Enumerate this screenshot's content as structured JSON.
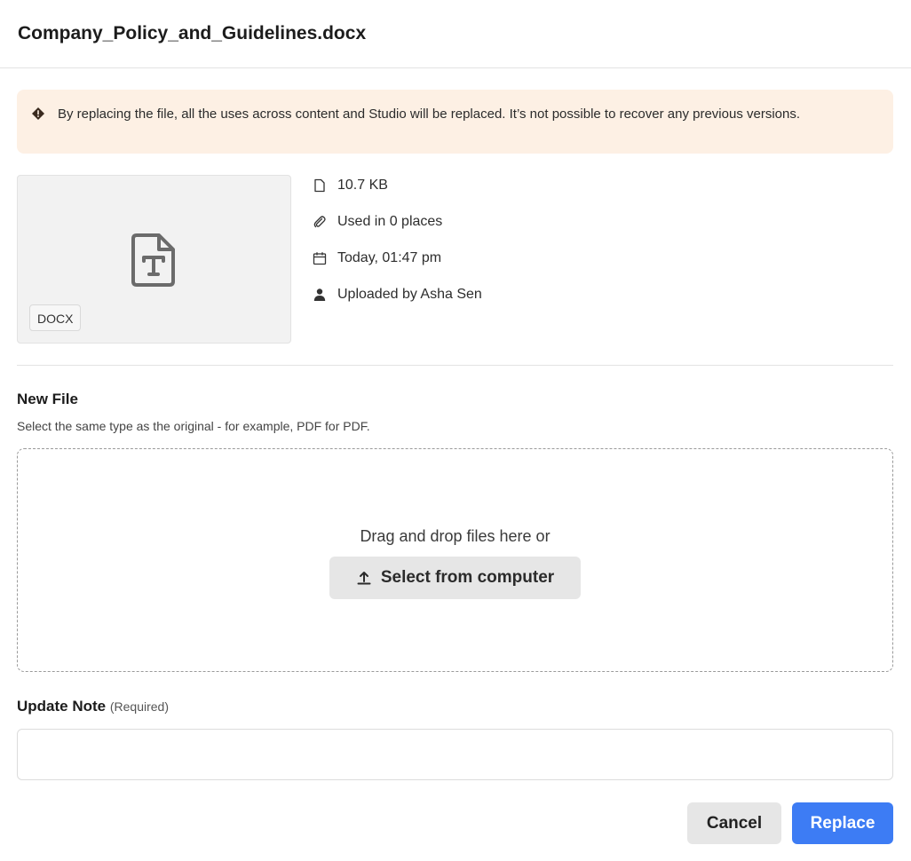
{
  "dialog": {
    "title": "Company_Policy_and_Guidelines.docx"
  },
  "warning": {
    "icon": "warning-diamond-icon",
    "text": "By replacing the file, all the uses across content and Studio will be replaced. It’s not possible to recover any previous versions."
  },
  "file": {
    "type_badge": "DOCX",
    "preview_icon": "text-document-icon",
    "meta": [
      {
        "icon": "file-icon",
        "text": "10.7 KB"
      },
      {
        "icon": "paperclip-icon",
        "text": "Used in 0 places"
      },
      {
        "icon": "calendar-icon",
        "text": "Today, 01:47 pm"
      },
      {
        "icon": "user-icon",
        "text": "Uploaded by Asha Sen"
      }
    ]
  },
  "new_file": {
    "title": "New File",
    "hint": "Select the same type as the original - for example, PDF for PDF.",
    "drop_text": "Drag and drop files here or",
    "select_label": "Select from computer"
  },
  "update_note": {
    "label": "Update Note",
    "required": "(Required)",
    "value": ""
  },
  "actions": {
    "cancel": "Cancel",
    "replace": "Replace"
  },
  "colors": {
    "warning_bg": "#fdf0e4",
    "primary": "#3d7cf4",
    "secondary_button": "#e6e6e6"
  }
}
